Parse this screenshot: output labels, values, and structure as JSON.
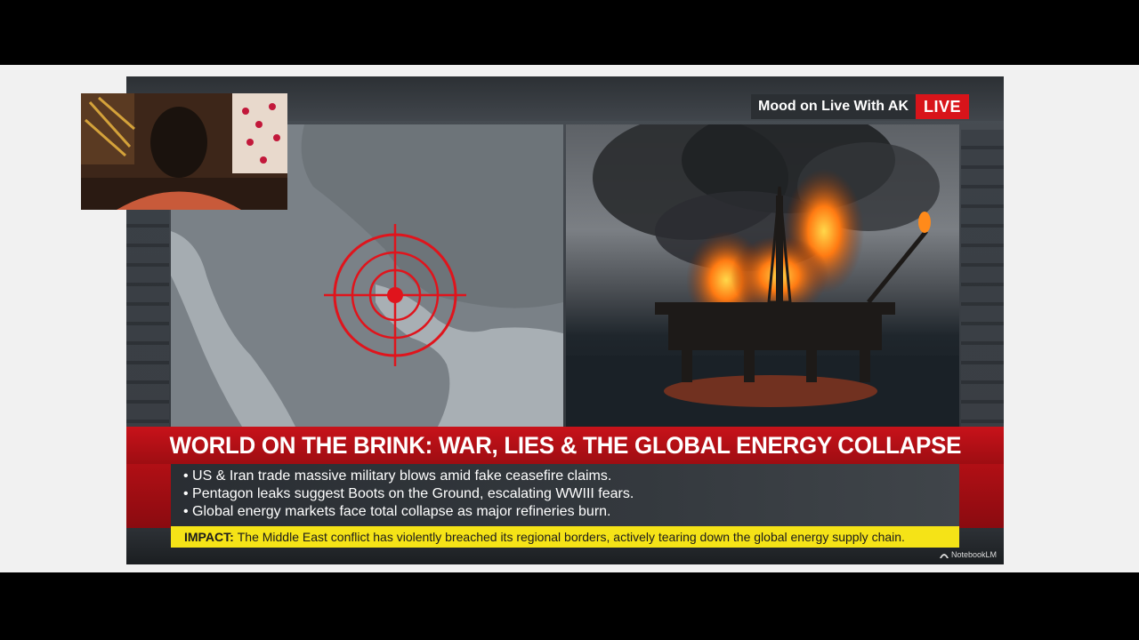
{
  "broadcast": {
    "host_label": "Mood on Live With AK",
    "live_label": "LIVE"
  },
  "headline": "WORLD ON THE BRINK: WAR, LIES & THE GLOBAL ENERGY COLLAPSE",
  "bullets": [
    "US & Iran trade massive military blows amid fake ceasefire claims.",
    "Pentagon leaks suggest Boots on the Ground, escalating WWIII fears.",
    "Global energy markets face total collapse as major refineries burn."
  ],
  "impact": {
    "label": "IMPACT:",
    "text": "The Middle East conflict has violently breached its regional borders, actively tearing down the global energy supply chain."
  },
  "watermark": "NotebookLM",
  "icons": {
    "target": "crosshair-target-icon",
    "watermark": "notebooklm-logo-icon"
  },
  "colors": {
    "live_red": "#d8141a",
    "headline_red": "#c8121a",
    "impact_yellow": "#f5e317",
    "target_red": "#e0141c"
  }
}
